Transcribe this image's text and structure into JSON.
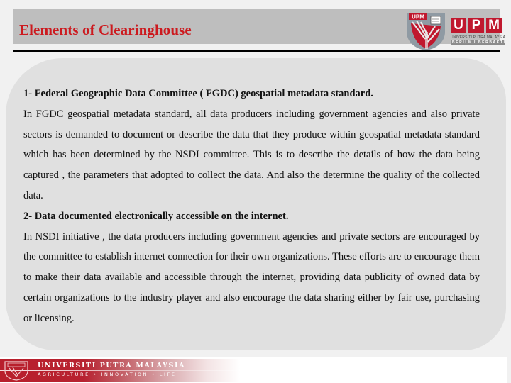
{
  "slide": {
    "title": "Elements of Clearinghouse",
    "colors": {
      "title_red": "#cc1a1f",
      "title_bar": "#bebebe",
      "panel": "#e0e0e0",
      "footer_red": "#b81f2c",
      "background": "#f1f1f1"
    }
  },
  "logo": {
    "icon": "upm-shield-logo",
    "letters": [
      "U",
      "P",
      "M"
    ],
    "shield_label": "UPM",
    "subtitle": "UNIVERSITI PUTRA MALAYSIA",
    "motto": "BERILMU BERBAKTI"
  },
  "content": {
    "sections": [
      {
        "heading": "1- Federal Geographic Data Committee ( FGDC) geospatial metadata standard.",
        "body": "In FGDC geospatial metadata standard, all data producers including government agencies and also private sectors is demanded to document or describe the data that they produce within geospatial metadata standard which has been determined by the NSDI committee. This is to describe the details of how the data being captured , the parameters that adopted to collect the data. And also the determine the quality of the collected data."
      },
      {
        "heading": "2- Data documented electronically accessible on the internet.",
        "body": "In NSDI initiative , the data producers including government agencies and private sectors are encouraged by the committee to establish internet connection for their own organizations. These efforts are to encourage them to make their data available and accessible through the internet, providing data publicity of owned data by certain organizations to the industry player and also encourage the data sharing either by fair use, purchasing or licensing."
      }
    ]
  },
  "footer": {
    "icon": "upm-crest-icon",
    "university_name": "UNIVERSITI PUTRA MALAYSIA",
    "tagline": "AGRICULTURE • INNOVATION • LIFE"
  }
}
